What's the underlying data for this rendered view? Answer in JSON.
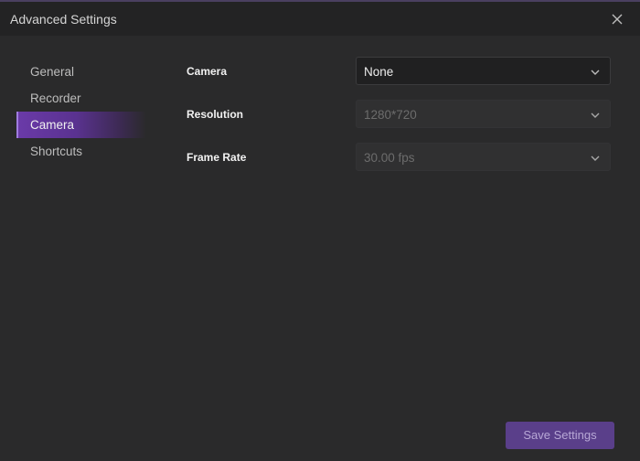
{
  "window": {
    "title": "Advanced Settings",
    "close_icon": "close-icon"
  },
  "sidebar": {
    "items": [
      {
        "label": "General",
        "active": false
      },
      {
        "label": "Recorder",
        "active": false
      },
      {
        "label": "Camera",
        "active": true
      },
      {
        "label": "Shortcuts",
        "active": false
      }
    ]
  },
  "camera_settings": {
    "camera": {
      "label": "Camera",
      "value": "None",
      "enabled": true,
      "icon": "chevron-down-icon"
    },
    "resolution": {
      "label": "Resolution",
      "value": "1280*720",
      "enabled": false,
      "icon": "chevron-down-icon"
    },
    "frame_rate": {
      "label": "Frame Rate",
      "value": "30.00 fps",
      "enabled": false,
      "icon": "chevron-down-icon"
    }
  },
  "footer": {
    "save_label": "Save Settings"
  },
  "colors": {
    "accent": "#6a3aa8",
    "background": "#2a2a2b",
    "titlebar": "#232324",
    "button": "#5a3f8a"
  }
}
